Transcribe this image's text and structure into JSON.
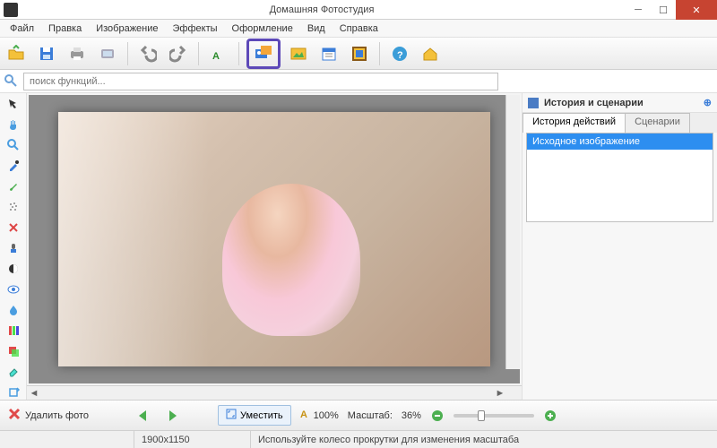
{
  "window": {
    "title": "Домашняя Фотостудия"
  },
  "menu": [
    "Файл",
    "Правка",
    "Изображение",
    "Эффекты",
    "Оформление",
    "Вид",
    "Справка"
  ],
  "search": {
    "placeholder": "поиск функций..."
  },
  "toolbar_icons": [
    "open-folder",
    "save",
    "print",
    "scan",
    "undo",
    "redo",
    "text",
    "combine-images",
    "image",
    "calendar",
    "frames",
    "help",
    "home"
  ],
  "sidetools": [
    "pointer",
    "hand",
    "zoom",
    "color-picker",
    "brush",
    "airbrush",
    "healing",
    "stamp",
    "contrast",
    "eye",
    "blur",
    "channels",
    "layers",
    "eraser",
    "rotate"
  ],
  "right": {
    "title": "История и сценарии",
    "tabs": [
      "История действий",
      "Сценарии"
    ],
    "history": [
      "Исходное изображение"
    ]
  },
  "bottom": {
    "delete": "Удалить фото",
    "fit": "Уместить",
    "oneToOne": "100%",
    "zoomLabel": "Масштаб:",
    "zoomValue": "36%"
  },
  "status": {
    "dimensions": "1900x1150",
    "hint": "Используйте колесо прокрутки для изменения масштаба"
  },
  "colors": {
    "accent": "#2d8ef0",
    "highlight": "#5d49b8"
  }
}
